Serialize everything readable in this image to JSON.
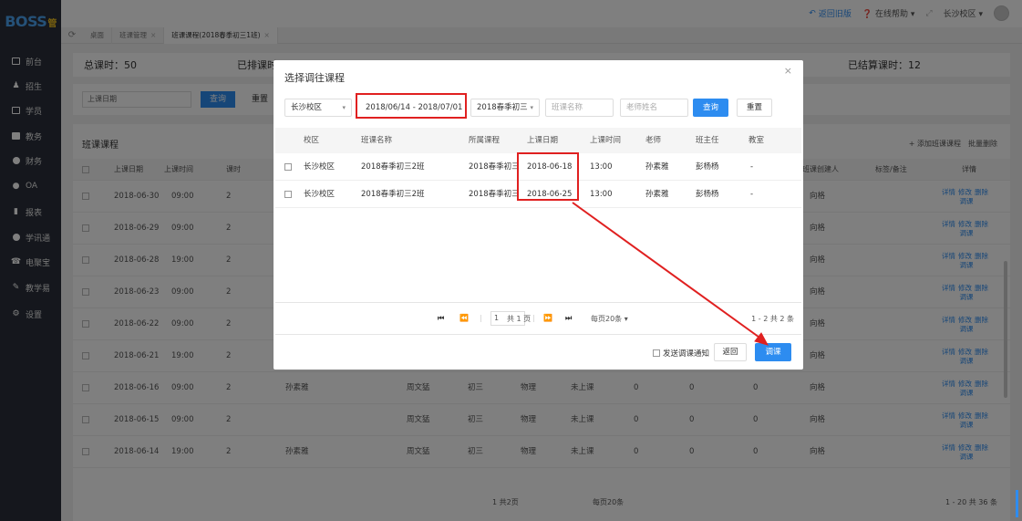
{
  "sidebar": {
    "logo_main": "BOSS",
    "logo_sub": "管",
    "items": [
      {
        "label": "前台",
        "icon": "calendar-icon"
      },
      {
        "label": "招生",
        "icon": "users-icon"
      },
      {
        "label": "学员",
        "icon": "id-card-icon"
      },
      {
        "label": "教务",
        "icon": "book-icon"
      },
      {
        "label": "财务",
        "icon": "money-icon"
      },
      {
        "label": "OA",
        "icon": "oa-icon"
      },
      {
        "label": "报表",
        "icon": "chart-icon"
      },
      {
        "label": "学讯通",
        "icon": "message-icon"
      },
      {
        "label": "电聚宝",
        "icon": "phone-icon"
      },
      {
        "label": "教学易",
        "icon": "teach-icon"
      },
      {
        "label": "设置",
        "icon": "gear-icon"
      }
    ]
  },
  "topbar": {
    "back_old": "返回旧版",
    "help": "在线帮助",
    "campus": "长沙校区"
  },
  "tabs": [
    {
      "label": "桌面",
      "closable": false
    },
    {
      "label": "班课管理",
      "closable": true
    },
    {
      "label": "班课课程(2018春季初三1班)",
      "closable": true
    }
  ],
  "background": {
    "stats": {
      "total": "总课时：50",
      "scheduled": "已排课时",
      "settled": "已结算课时：12"
    },
    "filter": {
      "date_placeholder": "上课日期",
      "query": "查询",
      "reset": "重置"
    },
    "list_title": "班课课程",
    "add_button": "添加班课课程",
    "batch_delete": "批量删除",
    "headers": {
      "date": "上课日期",
      "time": "上课时间",
      "hours": "课时",
      "creator": "班课创建人",
      "tag": "标签/备注",
      "ops": "详情"
    },
    "rows": [
      {
        "date": "2018-06-30",
        "time": "09:00",
        "hours": "2",
        "creator": "向格"
      },
      {
        "date": "2018-06-29",
        "time": "09:00",
        "hours": "2",
        "creator": "向格"
      },
      {
        "date": "2018-06-28",
        "time": "19:00",
        "hours": "2",
        "creator": "向格"
      },
      {
        "date": "2018-06-23",
        "time": "09:00",
        "hours": "2",
        "creator": "向格"
      },
      {
        "date": "2018-06-22",
        "time": "09:00",
        "hours": "2",
        "creator": "向格"
      },
      {
        "date": "2018-06-21",
        "time": "19:00",
        "hours": "2",
        "creator": "向格"
      },
      {
        "date": "2018-06-16",
        "time": "09:00",
        "hours": "2",
        "creator": "向格",
        "teacher": "孙素雅",
        "mgr": "周文猛",
        "grade": "初三",
        "subject": "物理",
        "status": "未上课",
        "n1": "0",
        "n2": "0",
        "n3": "0"
      },
      {
        "date": "2018-06-15",
        "time": "09:00",
        "hours": "2",
        "creator": "向格",
        "teacher": "",
        "mgr": "周文猛",
        "grade": "初三",
        "subject": "物理",
        "status": "未上课",
        "n1": "0",
        "n2": "0",
        "n3": "0"
      },
      {
        "date": "2018-06-14",
        "time": "19:00",
        "hours": "2",
        "creator": "向格",
        "teacher": "孙素雅",
        "mgr": "周文猛",
        "grade": "初三",
        "subject": "物理",
        "status": "未上课",
        "n1": "0",
        "n2": "0",
        "n3": "0"
      }
    ],
    "ops": {
      "detail": "详情",
      "edit": "修改",
      "delete": "删除",
      "adjust": "调课"
    },
    "pager": {
      "pages": "1 共2页",
      "per_page": "每页20条",
      "summary": "1 - 20 共 36 条"
    }
  },
  "modal": {
    "title": "选择调往课程",
    "filters": {
      "campus": "长沙校区",
      "date_range": "2018/06/14 - 2018/07/01",
      "course": "2018春季初三",
      "class_placeholder": "班课名称",
      "teacher_placeholder": "老师姓名",
      "query": "查询",
      "reset": "重置"
    },
    "headers": [
      "校区",
      "班课名称",
      "所属课程",
      "上课日期",
      "上课时间",
      "老师",
      "班主任",
      "教室"
    ],
    "rows": [
      {
        "campus": "长沙校区",
        "class": "2018春季初三2班",
        "course": "2018春季初三",
        "date": "2018-06-18",
        "time": "13:00",
        "teacher": "孙素雅",
        "head": "彭杨杨",
        "room": "-"
      },
      {
        "campus": "长沙校区",
        "class": "2018春季初三2班",
        "course": "2018春季初三",
        "date": "2018-06-25",
        "time": "13:00",
        "teacher": "孙素雅",
        "head": "彭杨杨",
        "room": "-"
      }
    ],
    "pager": {
      "page": "1",
      "total_pages": "共 1 页",
      "per_page": "每页20条",
      "summary": "1 - 2 共 2 条"
    },
    "notify_label": "发送调课通知",
    "back": "返回",
    "confirm": "调课"
  },
  "colors": {
    "primary": "#2d8cf0",
    "sidebar": "#2a2f3a",
    "annotation": "#e02020"
  }
}
